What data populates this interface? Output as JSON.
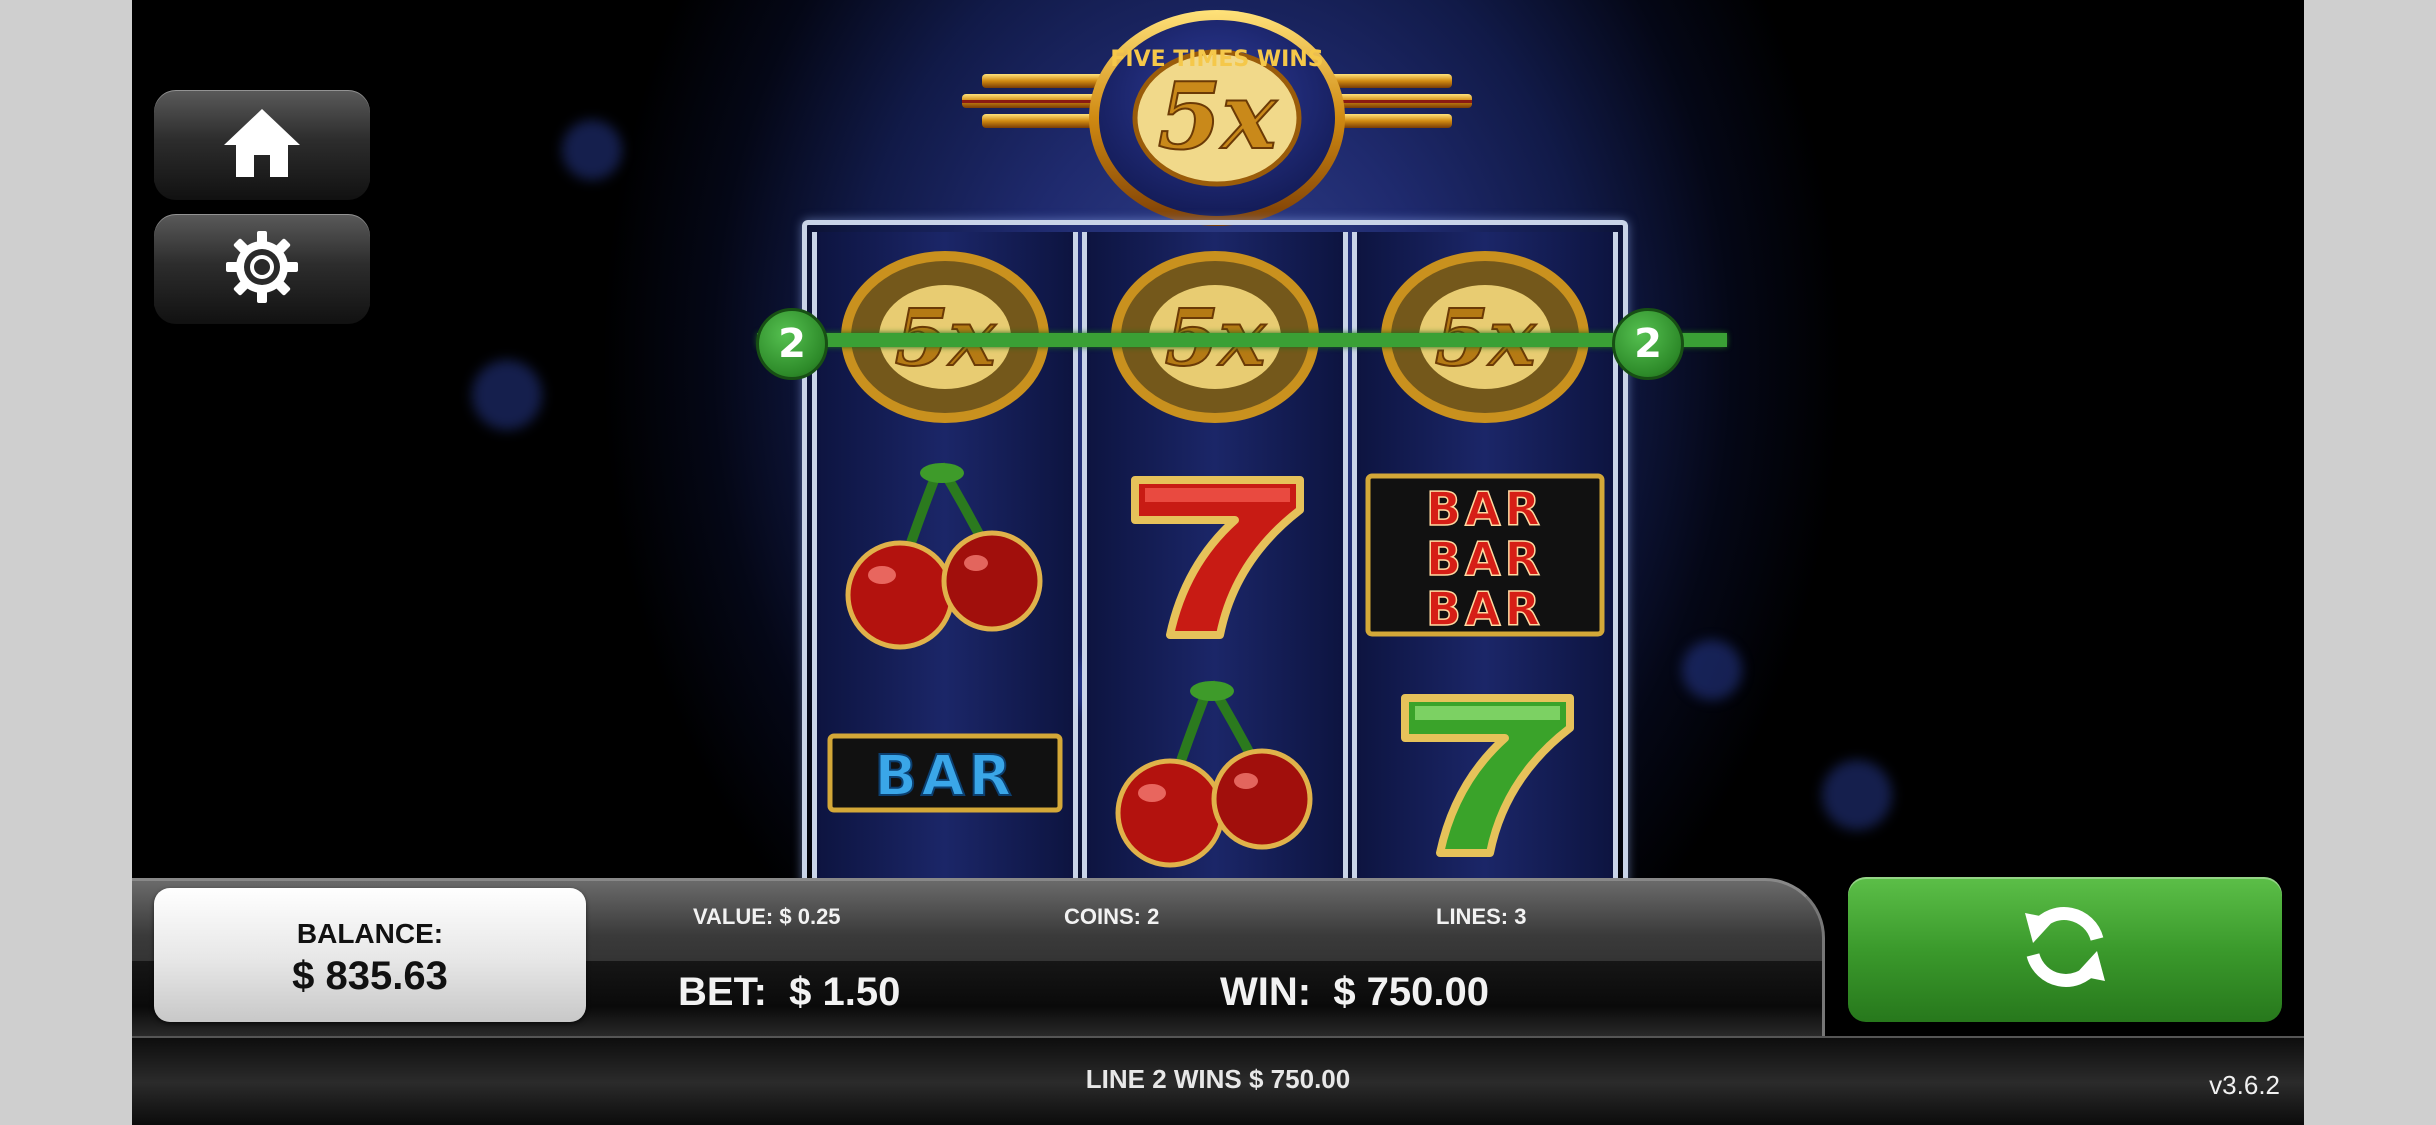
{
  "game": {
    "logo_text": "5x",
    "logo_ring_text": "FIVE TIMES WINS"
  },
  "buttons": {
    "home_icon": "home-icon",
    "settings_icon": "gear-icon",
    "spin_icon": "refresh-icon"
  },
  "reels": [
    [
      "5x",
      "cherries",
      "BAR"
    ],
    [
      "5x",
      "7",
      "cherries"
    ],
    [
      "5x",
      "BAR BAR BAR",
      "7"
    ]
  ],
  "payline": {
    "number": "2",
    "color": "#3aa035"
  },
  "stats": {
    "balance_label": "BALANCE:",
    "balance_value": "$ 835.63",
    "value_text": "VALUE: $ 0.25",
    "coins_text": "COINS: 2",
    "lines_text": "LINES: 3",
    "bet_label": "BET:",
    "bet_value": "$ 1.50",
    "win_label": "WIN:",
    "win_value": "$ 750.00"
  },
  "status": {
    "message": "LINE 2 WINS $ 750.00",
    "version": "v3.6.2"
  },
  "colors": {
    "spin_green": "#3b9a2c",
    "background_blue": "#1f2a6e"
  }
}
